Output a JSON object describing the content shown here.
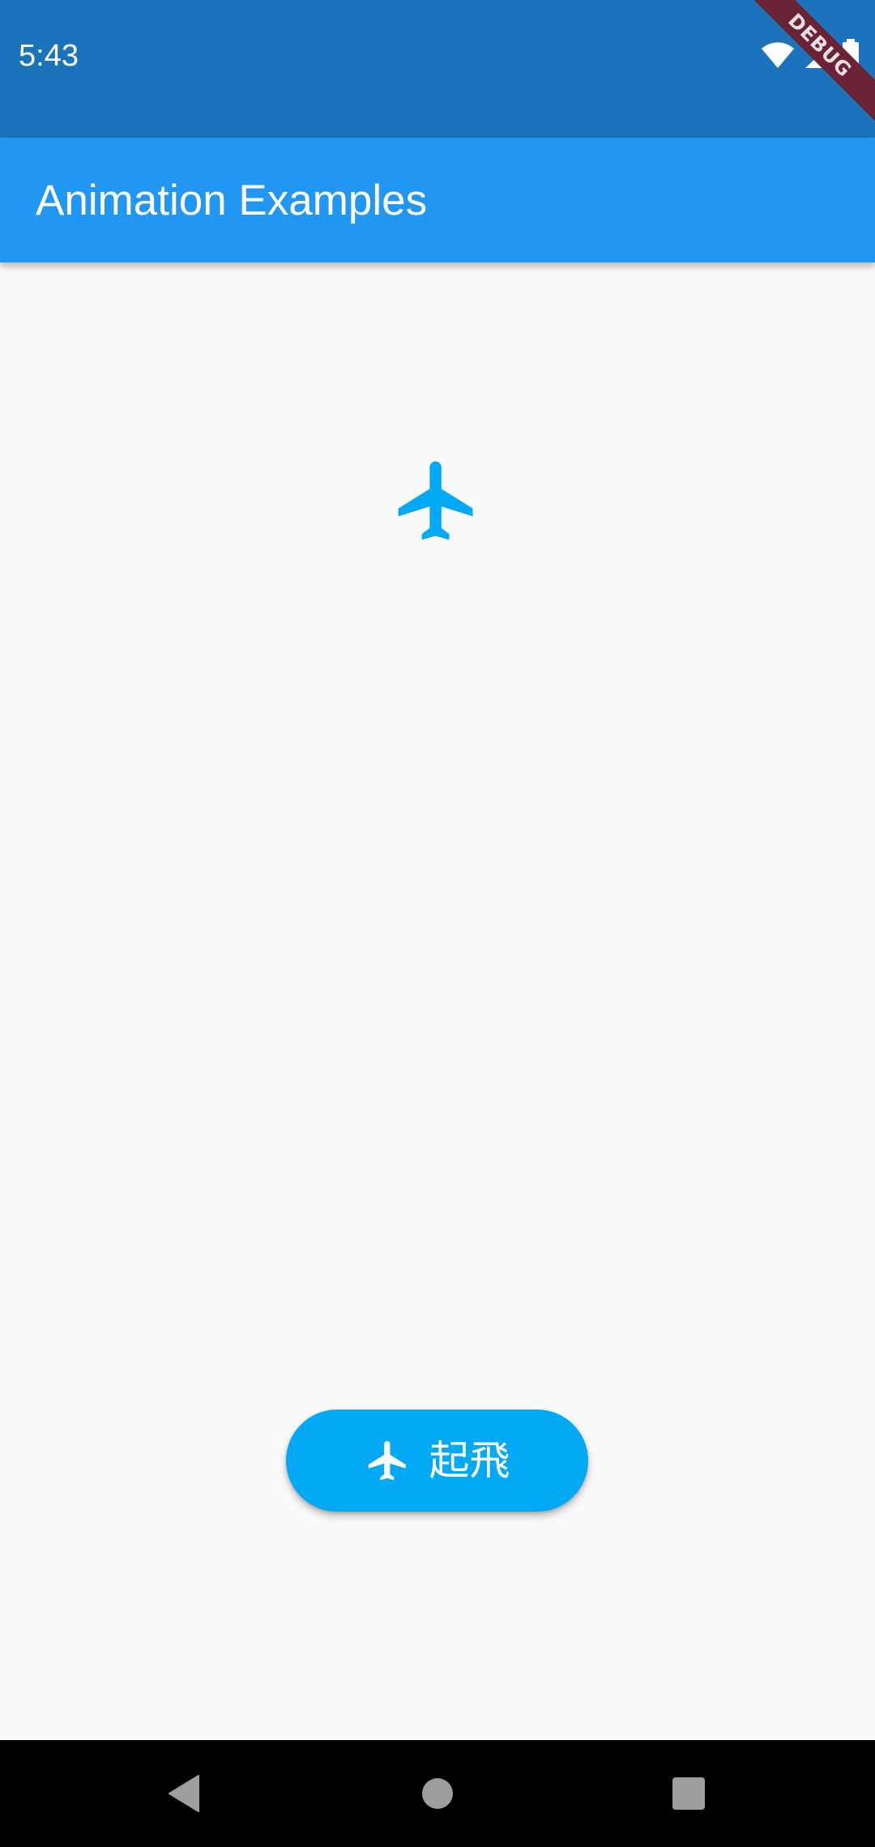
{
  "status_bar": {
    "time": "5:43",
    "debug_banner": "DEBUG",
    "icons": [
      "wifi-icon",
      "signal-icon",
      "battery-icon"
    ]
  },
  "app_bar": {
    "title": "Animation Examples"
  },
  "main": {
    "animated_icon": "airplane-icon"
  },
  "fab": {
    "icon": "airplane-icon",
    "label": "起飛"
  },
  "nav_bar": {
    "buttons": [
      "back-icon",
      "home-icon",
      "recents-icon"
    ]
  },
  "colors": {
    "status_bar": "#1b74bb",
    "app_bar": "#2196f3",
    "accent": "#03a9f4",
    "background": "#fafafa",
    "nav_bar": "#000000"
  }
}
